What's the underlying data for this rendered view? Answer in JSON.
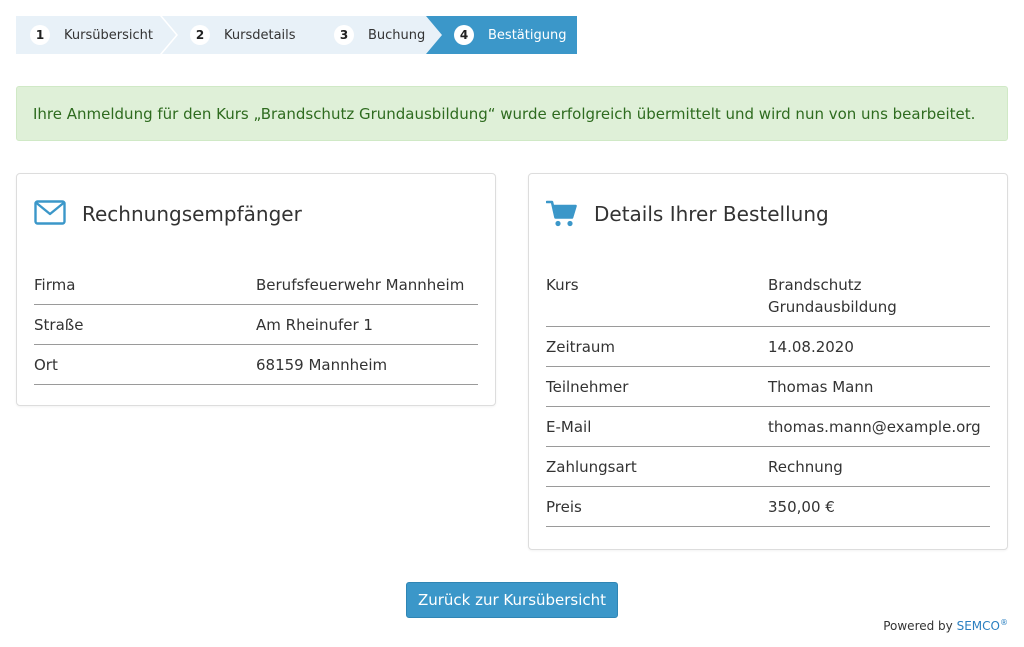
{
  "stepper": {
    "steps": [
      {
        "number": "1",
        "label": "Kursübersicht"
      },
      {
        "number": "2",
        "label": "Kursdetails"
      },
      {
        "number": "3",
        "label": "Buchung"
      },
      {
        "number": "4",
        "label": "Bestätigung"
      }
    ],
    "active_step": "4"
  },
  "alert": {
    "text": "Ihre Anmeldung für den Kurs „Brandschutz Grundausbildung“ wurde erfolgreich übermittelt und wird nun von uns bearbeitet."
  },
  "billing": {
    "title": "Rechnungsempfänger",
    "icon": "envelope-icon",
    "rows": [
      {
        "label": "Firma",
        "value": "Berufsfeuerwehr Mannheim"
      },
      {
        "label": "Straße",
        "value": "Am Rheinufer 1"
      },
      {
        "label": "Ort",
        "value": "68159 Mannheim"
      }
    ]
  },
  "order": {
    "title": "Details Ihrer Bestellung",
    "icon": "shopping-cart-icon",
    "rows": [
      {
        "label": "Kurs",
        "value": "Brandschutz Grundausbildung"
      },
      {
        "label": "Zeitraum",
        "value": "14.08.2020"
      },
      {
        "label": "Teilnehmer",
        "value": "Thomas Mann"
      },
      {
        "label": "E-Mail",
        "value": "thomas.mann@example.org"
      },
      {
        "label": "Zahlungsart",
        "value": "Rechnung"
      },
      {
        "label": "Preis",
        "value": "350,00 €"
      }
    ]
  },
  "back_button": {
    "label": "Zurück zur Kursübersicht"
  },
  "footer": {
    "powered_by": "Powered by",
    "brand": "SEMCO",
    "registered": "®"
  },
  "colors": {
    "accent": "#3b97c9",
    "success_bg": "#dff0d8",
    "success_text": "#2e6b1f",
    "step_bg": "#e8f1f8"
  }
}
